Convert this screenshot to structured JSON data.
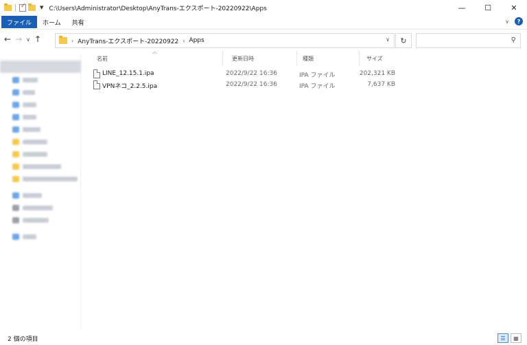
{
  "window": {
    "title": "C:\\Users\\Administrator\\Desktop\\AnyTrans-エクスポート-20220922\\Apps",
    "minimize": "—",
    "maximize": "☐",
    "close": "✕"
  },
  "ribbon": {
    "tabs": [
      "ファイル",
      "ホーム",
      "共有"
    ],
    "help_label": "?"
  },
  "address": {
    "crumbs": [
      "AnyTrans-エクスポート-20220922",
      "Apps"
    ],
    "search_placeholder": ""
  },
  "columns": {
    "name": "名前",
    "modified": "更新日時",
    "type": "種類",
    "size": "サイズ"
  },
  "files": [
    {
      "name": "LINE_12.15.1.ipa",
      "modified": "2022/9/22 16:36",
      "type": "IPA ファイル",
      "size": "202,321 KB"
    },
    {
      "name": "VPNネコ_2.2.5.ipa",
      "modified": "2022/9/22 16:36",
      "type": "IPA ファイル",
      "size": "7,637 KB"
    }
  ],
  "status": {
    "item_count": "2 個の項目"
  },
  "colors": {
    "accent": "#1a5fb4",
    "folder": "#f4c94c"
  }
}
